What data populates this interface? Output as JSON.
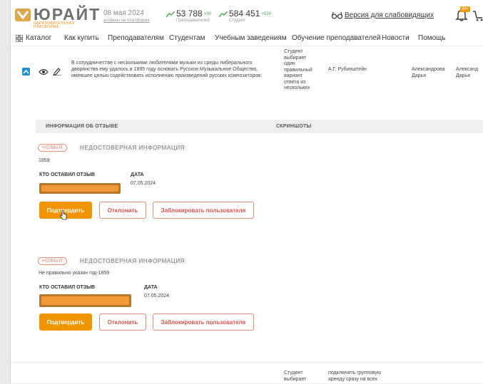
{
  "header": {
    "logo_word": "ЮРАЙТ",
    "logo_sub": "ОБРАЗОВАТЕЛЬНАЯ ПЛАТФОРМА",
    "date": "08 мая 2024",
    "date_sub": "активны на платформе",
    "stat1": {
      "value": "53 788",
      "delta": "+30",
      "caption": "Преподавателей"
    },
    "stat2": {
      "value": "584 451",
      "delta": "+530",
      "caption": "Студент"
    },
    "vision_label": "Версия для слабовидящих",
    "notif_badge": "99+"
  },
  "nav": {
    "catalog": "Каталог",
    "items": [
      "Как купить",
      "Преподавателям",
      "Студентам",
      "Учебным заведениям",
      "Обучение преподавателей",
      "Новости",
      "Помощь"
    ]
  },
  "row1": {
    "text": "В сотрудничестве с несколькими любителями музыки из среды либерального дворянства ему удалось в 1895 году основать Русское Музыкальное Общество, имевшее целью содействовать исполнению произведений русских композиторов:",
    "type_lines": [
      "Студент",
      "выбирает",
      "один",
      "правильный",
      "вариант",
      "ответа из",
      "нескольких"
    ],
    "answer": "А.Г. Рубинштейн",
    "author1": [
      "Александрова",
      "Дарья"
    ],
    "author2": [
      "Александ",
      "Дарья"
    ]
  },
  "section": {
    "info_header": "ИНФОРМАЦИЯ ОБ ОТЗЫВЕ",
    "screens_header": "СКРИНШОТЫ"
  },
  "reviews": [
    {
      "badge": "НОВЫЙ",
      "category": "НЕДОСТОВЕРНАЯ ИНФОРМАЦИЯ",
      "text": "1859",
      "who_label": "КТО ОСТАВИЛ ОТЗЫВ",
      "date_label": "ДАТА",
      "date": "07.05.2024",
      "confirm": "Подтвердить",
      "reject": "Отклонить",
      "block": "Заблокировать пользователя"
    },
    {
      "badge": "НОВЫЙ",
      "category": "НЕДОСТОВЕРНАЯ ИНФОРМАЦИЯ",
      "text": "Не правильно указан год-1859",
      "who_label": "КТО ОСТАВИЛ ОТЗЫВ",
      "date_label": "ДАТА",
      "date": "07.05.2024",
      "confirm": "Подтвердить",
      "reject": "Отклонить",
      "block": "Заблокировать пользователя"
    }
  ],
  "row2": {
    "type_lines": [
      "Студент",
      "выбирает"
    ],
    "answer_lines": [
      "подключить групповую",
      "аренду сразу на всех"
    ]
  },
  "colors": {
    "accent": "#f29400",
    "checkbox": "#1e8fd5",
    "reject": "#d9534f"
  }
}
